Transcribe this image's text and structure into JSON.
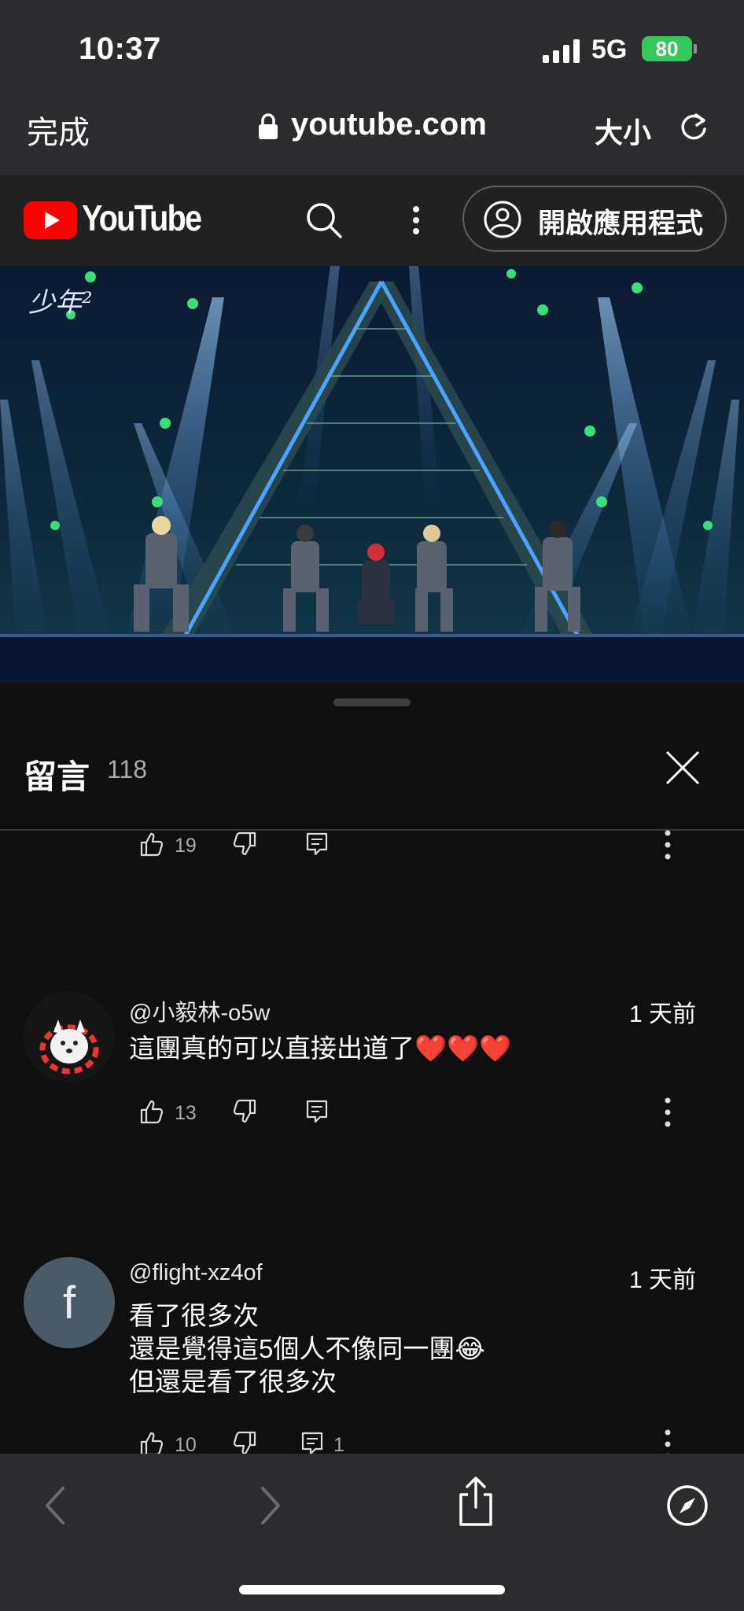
{
  "status_bar": {
    "time": "10:37",
    "network": "5G",
    "battery": "80"
  },
  "browser": {
    "done_label": "完成",
    "url": "youtube.com",
    "text_size_label": "大小",
    "icons": [
      "lock-icon",
      "reload-icon",
      "back-icon",
      "forward-icon",
      "share-icon",
      "compass-icon"
    ]
  },
  "youtube_header": {
    "logo_text": "YouTube",
    "open_app_label": "開啟應用程式",
    "brand_color": "#ff0000"
  },
  "video": {
    "overlay_logo_text": "少年²"
  },
  "comments_panel": {
    "title": "留言",
    "count": "118",
    "first_partial": {
      "likes": "19"
    },
    "comments": [
      {
        "author": "@小毅林-o5w",
        "time": "1 天前",
        "text": "這團真的可以直接出道了❤️❤️❤️",
        "likes": "13",
        "replies": ""
      },
      {
        "author": "@flight-xz4of",
        "avatar_letter": "f",
        "time": "1 天前",
        "text": "看了很多次\n還是覺得這5個人不像同一團😂\n但還是看了很多次",
        "likes": "10",
        "replies": "1"
      }
    ]
  }
}
